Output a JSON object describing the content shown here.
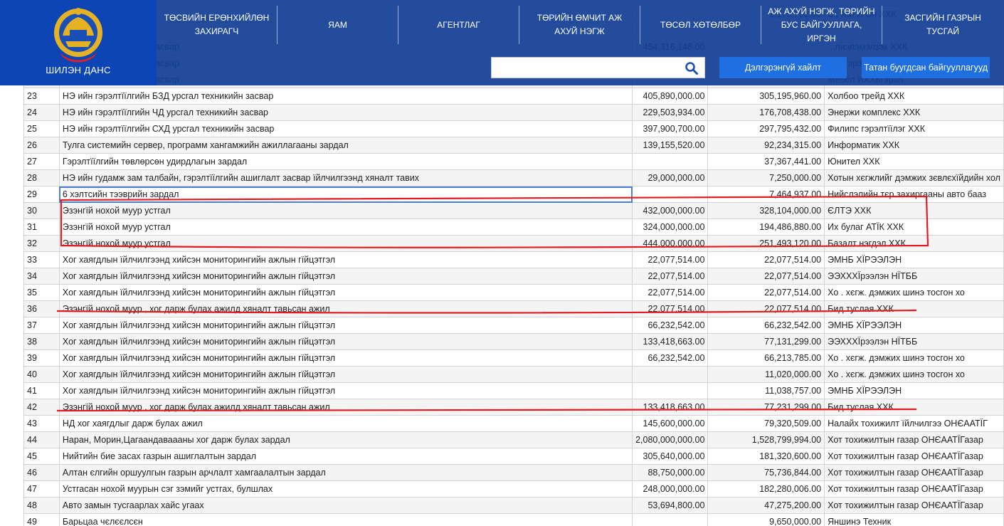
{
  "header": {
    "logo_text": "ШИЛЭН ДАНС",
    "nav": [
      "ТӨСВИЙН ЕРӨНХИЙЛӨН ЗАХИРАГЧ",
      "ЯАМ",
      "АГЕНТЛАГ",
      "ТӨРИЙН ӨМЧИТ АЖ АХУЙ НЭГЖ",
      "ТӨСӨЛ ХӨТӨЛБӨР",
      "АЖ АХУЙ НЭГЖ, ТӨРИЙН БУС БАЙГУУЛЛАГА, ИРГЭН",
      "ЗАСГИЙН ГАЗРЫН ТУСГАЙ"
    ],
    "search_value": "",
    "advanced_search_label": "Дэлгэрэнгүй хайлт",
    "tr_org_label": "Татан буугдсан байгууллагууд",
    "colors": {
      "bar": "#123e96",
      "logo": "#0d45b5",
      "button": "#1f6fe0",
      "annotation": "#e01b22"
    }
  },
  "table": {
    "rows": [
      {
        "n": "",
        "desc": "...ийгаалы зардал",
        "plan": "",
        "actual": "1,179,792.00",
        "vendor": "Эс Жи И Эн ХХК"
      },
      {
        "n": "",
        "desc": "...",
        "plan": "",
        "actual": "",
        "vendor": ""
      },
      {
        "n": "",
        "desc": "...д урсгал техникийн засвар",
        "plan": "454,316,148.00",
        "actual": "",
        "vendor": "...лиэлэмэлзэх ХХК"
      },
      {
        "n": "",
        "desc": "...д урсгал техникийн засвар",
        "plan": "700,000,000.00",
        "actual": "604,347,000.00",
        "vendor": "Тоо гэрэл ХХК"
      },
      {
        "n": "",
        "desc": "...д урсгал техникийн засвар",
        "plan": "",
        "actual": "",
        "vendor": "Мебел ИХХКгэрэл"
      },
      {
        "n": "23",
        "desc": "НЭ ийн гэрэлтїїлгийн БЗД урсгал техникийн засвар",
        "plan": "405,890,000.00",
        "actual": "305,195,960.00",
        "vendor": "Холбоо трейд ХХК"
      },
      {
        "n": "24",
        "desc": "НЭ ийн гэрэлтїїлгийн ЧД урсгал техникийн засвар",
        "plan": "229,503,934.00",
        "actual": "176,708,438.00",
        "vendor": "Энержи комплекс ХХК"
      },
      {
        "n": "25",
        "desc": "НЭ ийн гэрэлтїїлгийн СХД урсгал техникийн засвар",
        "plan": "397,900,700.00",
        "actual": "297,795,432.00",
        "vendor": "Филипс гэрэлтїїлэг ХХК"
      },
      {
        "n": "26",
        "desc": "Тулга системийн сервер, программ хангамжийн ажиллагааны зардал",
        "plan": "139,155,520.00",
        "actual": "92,234,315.00",
        "vendor": "Информатик ХХК"
      },
      {
        "n": "27",
        "desc": "Гэрэлтїїлгийн төвлөрсөн удирдлагын зардал",
        "plan": "",
        "actual": "37,367,441.00",
        "vendor": "Юнител ХХК"
      },
      {
        "n": "28",
        "desc": "НЭ ийн гудамж зам талбайн, гэрэлтїїлгийн ашиглалт засвар їйлчилгээнд хяналт тавих",
        "plan": "29,000,000.00",
        "actual": "7,250,000.00",
        "vendor": "Хотын хєгжлийг дэмжих зєвлєхїйдийн хол"
      },
      {
        "n": "29",
        "desc": "6 хэлтсийн тээврийн зардал",
        "plan": "",
        "actual": "7,464,937.00",
        "vendor": "Нийслэлийн тєр захиргааны авто бааз"
      },
      {
        "n": "30",
        "desc": "Эзэнгїй нохой муур устгал",
        "plan": "432,000,000.00",
        "actual": "328,104,000.00",
        "vendor": "ЄЛТЭ ХХК"
      },
      {
        "n": "31",
        "desc": "Эзэнгїй нохой муур устгал",
        "plan": "324,000,000.00",
        "actual": "194,486,880.00",
        "vendor": "Их булаг АТЇК ХХК"
      },
      {
        "n": "32",
        "desc": "Эзэнгїй нохой муур устгал",
        "plan": "444,000,000.00",
        "actual": "251,493,120.00",
        "vendor": "Базалт нэгдэл ХХК"
      },
      {
        "n": "33",
        "desc": "Хог хаягдлын їйлчилгээнд хийсэн мониторингийн ажлын гїйцэтгэл",
        "plan": "22,077,514.00",
        "actual": "22,077,514.00",
        "vendor": "ЭМНБ ХЇРЭЭЛЭН"
      },
      {
        "n": "34",
        "desc": "Хог хаягдлын їйлчилгээнд хийсэн мониторингийн ажлын гїйцэтгэл",
        "plan": "22,077,514.00",
        "actual": "22,077,514.00",
        "vendor": "ЭЭХХХЇрээлэн НЇТББ"
      },
      {
        "n": "35",
        "desc": "Хог хаягдлын їйлчилгээнд хийсэн мониторингийн ажлын гїйцэтгэл",
        "plan": "22,077,514.00",
        "actual": "22,077,514.00",
        "vendor": "Хо . хєгж. дэмжих шинэ тосгон хо"
      },
      {
        "n": "36",
        "desc": "Эзэнгїй нохой муур , хог дарж булах ажилд хяналт тавьсан ажил",
        "plan": "22,077,514.00",
        "actual": "22,077,514.00",
        "vendor": "Бид туслая ХХК"
      },
      {
        "n": "37",
        "desc": "Хог хаягдлын їйлчилгээнд хийсэн мониторингийн ажлын гїйцэтгэл",
        "plan": "66,232,542.00",
        "actual": "66,232,542.00",
        "vendor": "ЭМНБ ХЇРЭЭЛЭН"
      },
      {
        "n": "38",
        "desc": "Хог хаягдлын їйлчилгээнд хийсэн мониторингийн ажлын гїйцэтгэл",
        "plan": "133,418,663.00",
        "actual": "77,131,299.00",
        "vendor": "ЭЭХХХЇрээлэн НЇТББ"
      },
      {
        "n": "39",
        "desc": "Хог хаягдлын їйлчилгээнд хийсэн мониторингийн ажлын гїйцэтгэл",
        "plan": "66,232,542.00",
        "actual": "66,213,785.00",
        "vendor": "Хо . хєгж. дэмжих шинэ тосгон хо"
      },
      {
        "n": "40",
        "desc": "Хог хаягдлын їйлчилгээнд хийсэн мониторингийн ажлын гїйцэтгэл",
        "plan": "",
        "actual": "11,020,000.00",
        "vendor": "Хо . хєгж. дэмжих шинэ тосгон хо"
      },
      {
        "n": "41",
        "desc": "Хог хаягдлын їйлчилгээнд хийсэн мониторингийн ажлын гїйцэтгэл",
        "plan": "",
        "actual": "11,038,757.00",
        "vendor": "ЭМНБ ХЇРЭЭЛЭН"
      },
      {
        "n": "42",
        "desc": "Эзэнгїй нохой муур , хог дарж булах ажилд хяналт тавьсан ажил",
        "plan": "133,418,663.00",
        "actual": "77,231,299.00",
        "vendor": "Бид туслая ХХК"
      },
      {
        "n": "43",
        "desc": "НД хог хаягдлыг дарж булах ажил",
        "plan": "145,600,000.00",
        "actual": "79,320,509.00",
        "vendor": "Налайх тохижилт їйлчилгээ ОНЄААТЇГ"
      },
      {
        "n": "44",
        "desc": "Наран, Морин,Цагаандаваааны хог дарж булах зардал",
        "plan": "2,080,000,000.00",
        "actual": "1,528,799,994.00",
        "vendor": "Хот тохижилтын газар ОНЄААТЇГазар"
      },
      {
        "n": "45",
        "desc": "Нийтийн бие засах газрын ашиглалтын зардал",
        "plan": "305,640,000.00",
        "actual": "181,320,600.00",
        "vendor": "Хот тохижилтын газар ОНЄААТЇГазар"
      },
      {
        "n": "46",
        "desc": "Алтан єлгийн оршуулгын газрын арчлалт хамгаалалтын зардал",
        "plan": "88,750,000.00",
        "actual": "75,736,844.00",
        "vendor": "Хот тохижилтын газар ОНЄААТЇГазар"
      },
      {
        "n": "47",
        "desc": "Устгасан нохой муурын сэг зэмийг устгах, булшлах",
        "plan": "248,000,000.00",
        "actual": "182,280,006.00",
        "vendor": "Хот тохижилтын газар ОНЄААТЇГазар"
      },
      {
        "n": "48",
        "desc": "Авто замын тусгаарлах хайс угаах",
        "plan": "53,694,800.00",
        "actual": "47,275,200.00",
        "vendor": "Хот тохижилтын газар ОНЄААТЇГазар"
      },
      {
        "n": "49",
        "desc": "Барьцаа чєлєєлсєн",
        "plan": "",
        "actual": "9,650,000.00",
        "vendor": "Яншинэ Техник"
      }
    ]
  }
}
